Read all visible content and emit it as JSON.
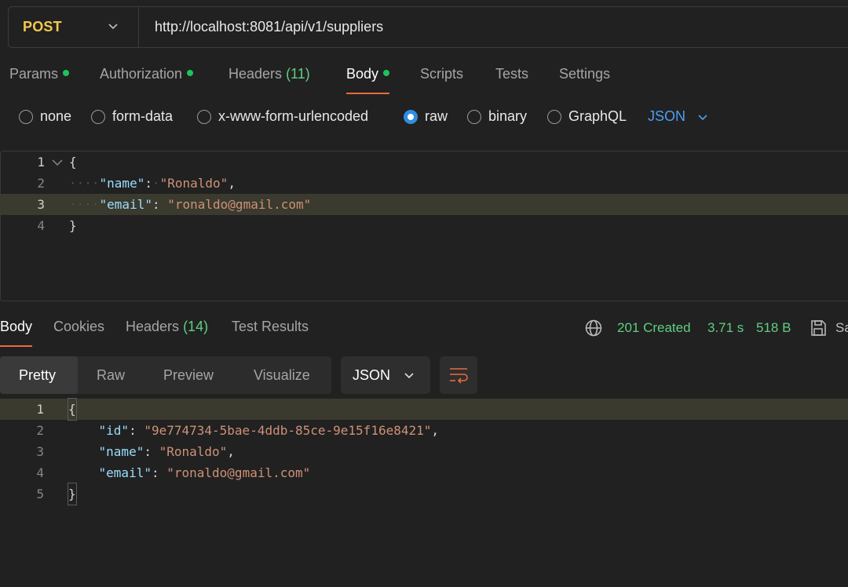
{
  "request": {
    "method": "POST",
    "url": "http://localhost:8081/api/v1/suppliers"
  },
  "request_tabs": [
    {
      "label": "Params",
      "dot": true
    },
    {
      "label": "Authorization",
      "dot": true
    },
    {
      "label": "Headers",
      "count": "(11)"
    },
    {
      "label": "Body",
      "dot": true,
      "active": true
    },
    {
      "label": "Scripts"
    },
    {
      "label": "Tests"
    },
    {
      "label": "Settings"
    }
  ],
  "body_types": {
    "options": [
      "none",
      "form-data",
      "x-www-form-urlencoded",
      "raw",
      "binary",
      "GraphQL"
    ],
    "selected": "raw",
    "language": "JSON"
  },
  "request_body": {
    "line_numbers": [
      "1",
      "2",
      "3",
      "4"
    ],
    "open_brace": "{",
    "close_brace": "}",
    "indent": "····",
    "fields": [
      {
        "key": "\"name\"",
        "value": "\"Ronaldo\""
      },
      {
        "key": "\"email\"",
        "value": "\"ronaldo@gmail.com\""
      }
    ]
  },
  "response_tabs": [
    {
      "label": "Body",
      "active": true
    },
    {
      "label": "Cookies"
    },
    {
      "label": "Headers",
      "count": "(14)"
    },
    {
      "label": "Test Results"
    }
  ],
  "response_status": {
    "status": "201 Created",
    "time": "3.71 s",
    "size": "518 B",
    "save_label": "Sa"
  },
  "response_format": {
    "modes": [
      "Pretty",
      "Raw",
      "Preview",
      "Visualize"
    ],
    "active_mode": "Pretty",
    "language": "JSON"
  },
  "response_body": {
    "line_numbers": [
      "1",
      "2",
      "3",
      "4",
      "5"
    ],
    "open_brace": "{",
    "close_brace": "}",
    "fields": [
      {
        "key": "\"id\"",
        "value": "\"9e774734-5bae-4ddb-85ce-9e15f16e8421\""
      },
      {
        "key": "\"name\"",
        "value": "\"Ronaldo\""
      },
      {
        "key": "\"email\"",
        "value": "\"ronaldo@gmail.com\""
      }
    ]
  },
  "colors": {
    "method": "#f2c94c",
    "status_ok": "#5fcf80",
    "accent": "#e86b3c",
    "link_blue": "#4d9ef5",
    "json_key": "#9cdcfe",
    "json_string": "#ce9178"
  }
}
